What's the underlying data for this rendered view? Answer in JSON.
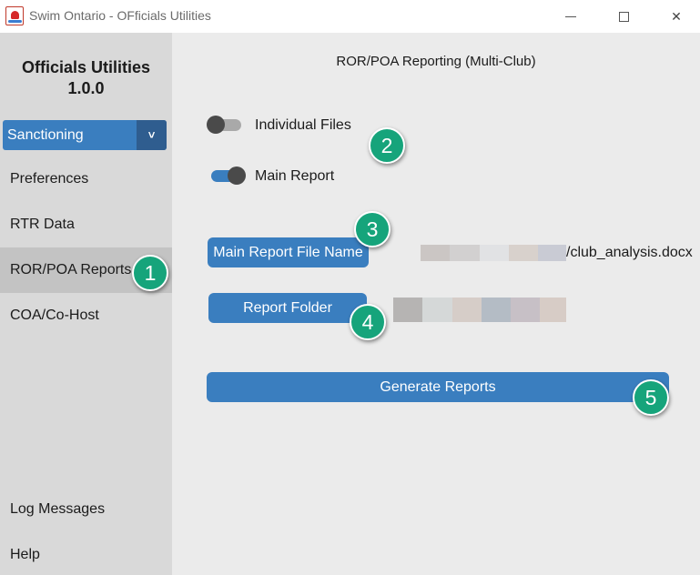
{
  "window": {
    "title": "Swim Ontario - OFficials Utilities",
    "icon": "swim-ontario-logo-icon",
    "controls": {
      "minimize": "minimize-icon",
      "maximize": "maximize-icon",
      "close": "✕"
    }
  },
  "sidebar": {
    "app_title": "Officials Utilities",
    "version": "1.0.0",
    "dropdown": {
      "selected": "Sanctioning",
      "arrow": "˅"
    },
    "items": [
      {
        "label": "Preferences"
      },
      {
        "label": "RTR Data"
      },
      {
        "label": "ROR/POA Reports",
        "active": true
      },
      {
        "label": "COA/Co-Host"
      }
    ],
    "bottom_items": [
      {
        "label": "Log Messages"
      },
      {
        "label": "Help"
      }
    ]
  },
  "main": {
    "heading": "ROR/POA Reporting (Multi-Club)",
    "toggles": [
      {
        "label": "Individual Files",
        "on": false
      },
      {
        "label": "Main Report",
        "on": true
      }
    ],
    "main_report_button": "Main Report File Name",
    "main_report_path": "/club_analysis.docx",
    "report_folder_button": "Report Folder",
    "generate_button": "Generate Reports"
  },
  "badges": [
    "1",
    "2",
    "3",
    "4",
    "5"
  ],
  "colors": {
    "accent": "#3a7ebf",
    "accent_dark": "#2f5d8f",
    "badge": "#16a47b",
    "sidebar_bg": "#d9d9d9",
    "main_bg": "#ebebeb"
  }
}
